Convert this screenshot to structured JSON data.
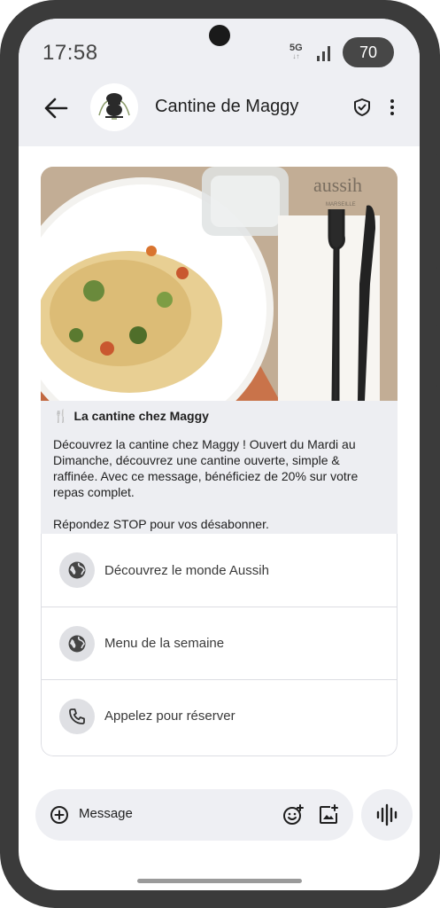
{
  "status_bar": {
    "time": "17:58",
    "network": "5G",
    "battery": "70"
  },
  "header": {
    "title": "Cantine de Maggy",
    "back_icon": "arrow-back-icon",
    "verified_icon": "shield-check-icon",
    "more_icon": "more-vert-icon"
  },
  "image": {
    "plate_text": "aussih",
    "plate_subtext": "MARSEILLE"
  },
  "message": {
    "title": "La cantine chez Maggy",
    "title_icon": "fork-knife-icon",
    "body": "Découvrez la cantine chez Maggy ! Ouvert du Mardi au Dimanche, découvrez une cantine ouverte, simple & raffinée. Avec ce message, bénéficiez de 20% sur votre repas complet.\n\nRépondez STOP pour vos désabonner."
  },
  "actions": [
    {
      "label": "Découvrez le monde Aussih",
      "icon": "globe-icon"
    },
    {
      "label": "Menu de la semaine",
      "icon": "globe-icon"
    },
    {
      "label": "Appelez pour réserver",
      "icon": "phone-icon"
    }
  ],
  "compose": {
    "placeholder": "Message",
    "add_icon": "add-circle-icon",
    "emoji_icon": "emoji-add-icon",
    "image_icon": "image-add-icon",
    "voice_icon": "voice-waveform-icon"
  },
  "colors": {
    "frame": "#3b3b3b",
    "header_bg": "#eeeff3",
    "card_body_bg": "#edeef2",
    "action_icon_bg": "#dfe0e4"
  }
}
